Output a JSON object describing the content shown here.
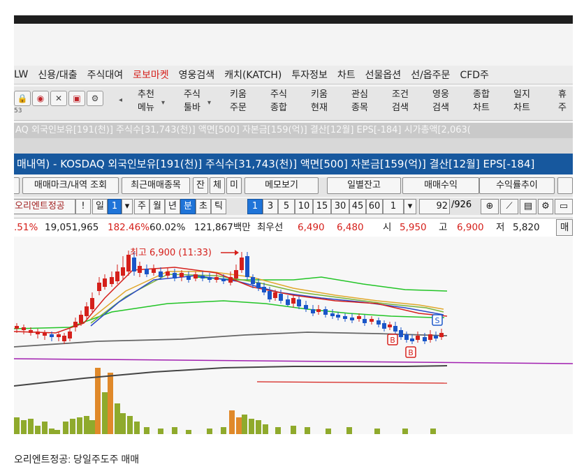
{
  "menu": [
    "LW",
    "신용/대출",
    "주식대여",
    "로보마켓",
    "영웅검색",
    "캐치(KATCH)",
    "투자정보",
    "차트",
    "선물옵션",
    "선/옵주문",
    "CFD주"
  ],
  "toolbar": {
    "icons": [
      "lock-icon",
      "camera-icon",
      "clock-icon",
      "monitor-icon",
      "gear-icon"
    ],
    "small_label": "53",
    "buttons": [
      {
        "top": "추천",
        "bottom": "메뉴",
        "dropdown": true
      },
      {
        "top": "주식",
        "bottom": "툴바",
        "dropdown": true
      },
      {
        "top": "키움",
        "bottom": "주문",
        "dropdown": false
      },
      {
        "top": "주식",
        "bottom": "종합",
        "dropdown": false
      },
      {
        "top": "키움",
        "bottom": "현재",
        "dropdown": false
      },
      {
        "top": "관심",
        "bottom": "종목",
        "dropdown": false
      },
      {
        "top": "조건",
        "bottom": "검색",
        "dropdown": false
      },
      {
        "top": "영웅",
        "bottom": "검색",
        "dropdown": false
      },
      {
        "top": "종합",
        "bottom": "차트",
        "dropdown": false
      },
      {
        "top": "일지",
        "bottom": "차트",
        "dropdown": false
      },
      {
        "top": "휴",
        "bottom": "주",
        "dropdown": false
      }
    ]
  },
  "info_strip": "AQ 외국인보유[191(천)] 주식수[31,743(천)] 액면[500] 자본금[159(억)] 결산[12월] EPS[-184] 시가총액[2,063(",
  "title_bar": "매내역) - KOSDAQ 외국인보유[191(천)] 주식수[31,743(천)] 액면[500] 자본금[159(억)] 결산[12월] EPS[-184]",
  "row1": {
    "buttons": [
      "매매마크/내역 조회",
      "최근매매종목",
      "잔",
      "체",
      "미",
      "메모보기",
      "일별잔고",
      "매매수익",
      "수익률추이"
    ]
  },
  "row2": {
    "name_field": "오리엔트정공",
    "period_tabs": [
      "일",
      "주",
      "월",
      "년",
      "분",
      "초",
      "틱"
    ],
    "active_period": "분",
    "minute_options": [
      "1",
      "3",
      "5",
      "10",
      "15",
      "30",
      "45",
      "60"
    ],
    "active_minute": "1",
    "interval_value": "1",
    "page_current": "92",
    "page_total": "/926"
  },
  "quote": {
    "change_pct": ".51%",
    "volume": "19,051,965",
    "ratio": "182.46%",
    "ratio2": "60.02%",
    "amount": "121,867백만",
    "best_label": "최우선",
    "ask": "6,490",
    "bid": "6,480",
    "open_label": "시",
    "open": "5,950",
    "high_label": "고",
    "high": "6,900",
    "low_label": "저",
    "low": "5,820",
    "right_btn": "매"
  },
  "chart_annotation": "최고 6,900 (11:33)",
  "chart_markers": [
    {
      "label": "S",
      "type": "sell"
    },
    {
      "label": "B",
      "type": "buy"
    },
    {
      "label": "B",
      "type": "buy"
    }
  ],
  "caption": "오리엔트정공:  당일주도주 매매",
  "colors": {
    "title_bg": "#17589e",
    "up": "#d5201b",
    "down": "#1a56c8",
    "volume_up": "#e0892a",
    "volume_down": "#8faa2c",
    "active": "#1f74d8"
  }
}
